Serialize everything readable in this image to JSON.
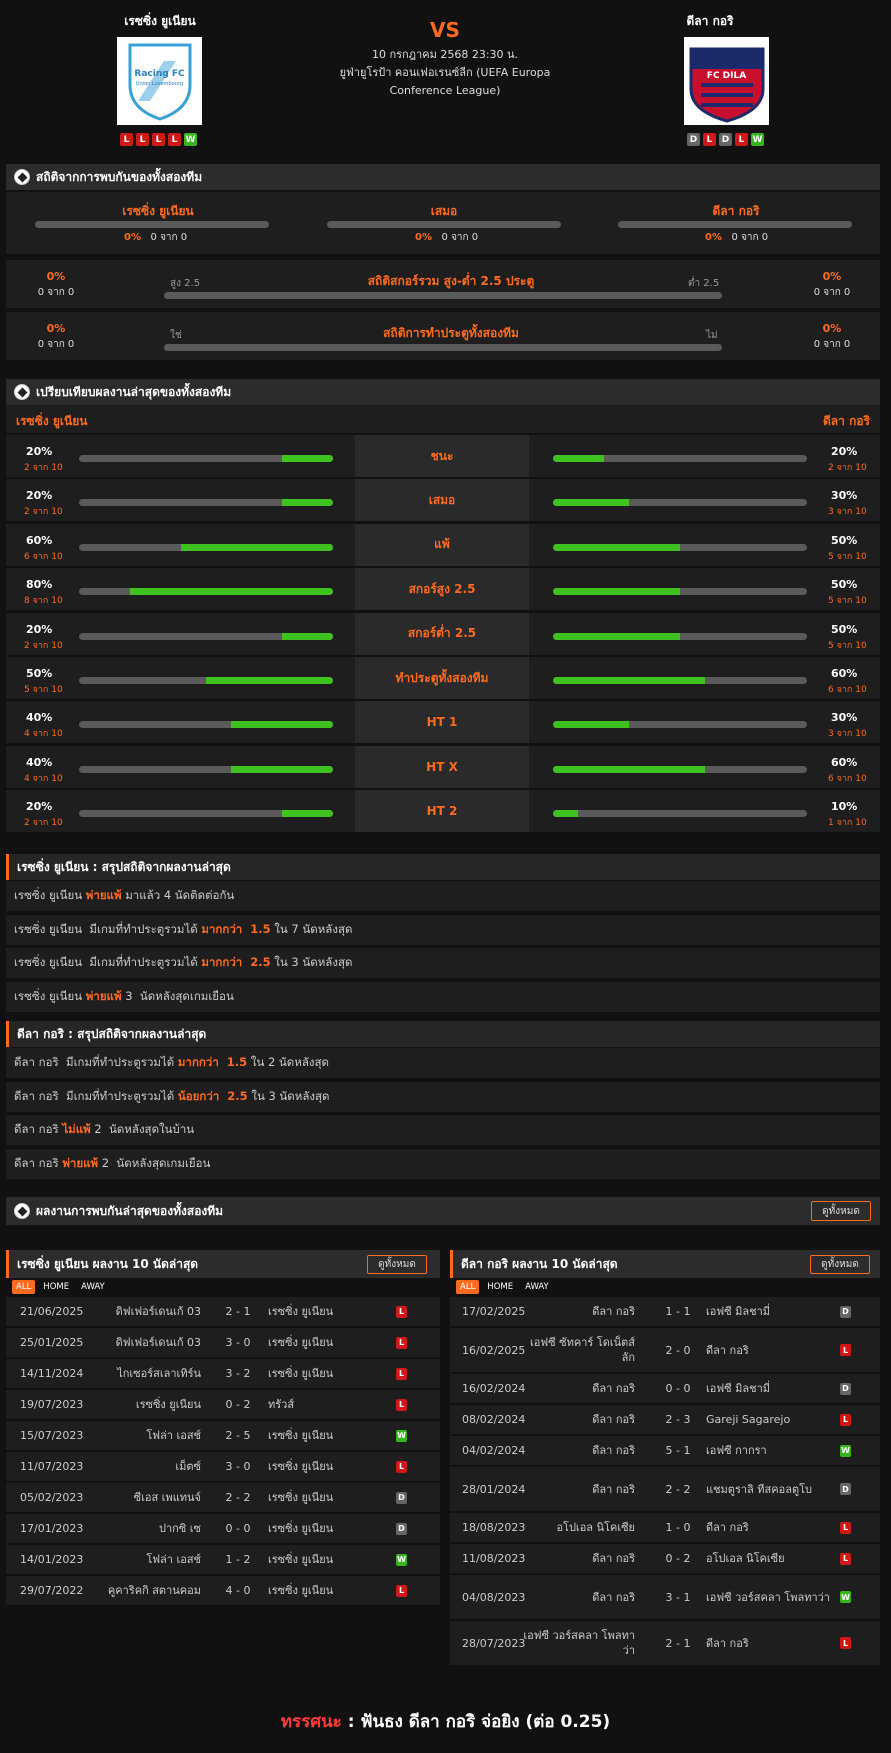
{
  "header": {
    "home_name": "เรซซิ่ง ยูเนียน",
    "away_name": "ดีลา กอริ",
    "vs": "VS",
    "datetime": "10 กรกฎาคม 2568 23:30 น.",
    "competition_line1": "ยูฟ่ายูโรป้า คอนเฟอเรนซ์ลีก (UEFA Europa",
    "competition_line2": "Conference League)",
    "home_logo_text": "Racing FC",
    "home_logo_sub": "Union Luxembourg",
    "away_logo_text": "FC DILA",
    "home_form": [
      "L",
      "L",
      "L",
      "L",
      "W"
    ],
    "away_form": [
      "D",
      "L",
      "D",
      "L",
      "W"
    ]
  },
  "h2h": {
    "title": "สถิติจากการพบกันของทั้งสองทีม",
    "cols": [
      {
        "label": "เรซซิ่ง ยูเนียน",
        "pct": "0%",
        "sub": "0 จาก 0"
      },
      {
        "label": "เสมอ",
        "pct": "0%",
        "sub": "0 จาก 0"
      },
      {
        "label": "ดีลา กอริ",
        "pct": "0%",
        "sub": "0 จาก 0"
      }
    ],
    "ou": {
      "title": "สถิติสกอร์รวม สูง-ต่ำ 2.5 ประตู",
      "left_label": "สูง 2.5",
      "right_label": "ต่ำ 2.5",
      "left_pct": "0%",
      "left_sub": "0 จาก 0",
      "right_pct": "0%",
      "right_sub": "0 จาก 0"
    },
    "btts": {
      "title": "สถิติการทำประตูทั้งสองทีม",
      "left_label": "ใช่",
      "right_label": "ไม่",
      "left_pct": "0%",
      "left_sub": "0 จาก 0",
      "right_pct": "0%",
      "right_sub": "0 จาก 0"
    }
  },
  "compare": {
    "title": "เปรียบเทียบผลงานล่าสุดของทั้งสองทีม",
    "home": "เรซซิ่ง ยูเนียน",
    "away": "ดีลา กอริ",
    "rows": [
      {
        "label": "ชนะ",
        "hp": "20%",
        "hs": "2 จาก 10",
        "hv": 0.2,
        "ap": "20%",
        "as": "2 จาก 10",
        "av": 0.2
      },
      {
        "label": "เสมอ",
        "hp": "20%",
        "hs": "2 จาก 10",
        "hv": 0.2,
        "ap": "30%",
        "as": "3 จาก 10",
        "av": 0.3
      },
      {
        "label": "แพ้",
        "hp": "60%",
        "hs": "6 จาก 10",
        "hv": 0.6,
        "ap": "50%",
        "as": "5 จาก 10",
        "av": 0.5
      },
      {
        "label": "สกอร์สูง 2.5",
        "hp": "80%",
        "hs": "8 จาก 10",
        "hv": 0.8,
        "ap": "50%",
        "as": "5 จาก 10",
        "av": 0.5
      },
      {
        "label": "สกอร์ต่ำ 2.5",
        "hp": "20%",
        "hs": "2 จาก 10",
        "hv": 0.2,
        "ap": "50%",
        "as": "5 จาก 10",
        "av": 0.5
      },
      {
        "label": "ทำประตูทั้งสองทีม",
        "hp": "50%",
        "hs": "5 จาก 10",
        "hv": 0.5,
        "ap": "60%",
        "as": "6 จาก 10",
        "av": 0.6
      },
      {
        "label": "HT 1",
        "hp": "40%",
        "hs": "4 จาก 10",
        "hv": 0.4,
        "ap": "30%",
        "as": "3 จาก 10",
        "av": 0.3
      },
      {
        "label": "HT X",
        "hp": "40%",
        "hs": "4 จาก 10",
        "hv": 0.4,
        "ap": "60%",
        "as": "6 จาก 10",
        "av": 0.6
      },
      {
        "label": "HT 2",
        "hp": "20%",
        "hs": "2 จาก 10",
        "hv": 0.2,
        "ap": "10%",
        "as": "1 จาก 10",
        "av": 0.1
      }
    ]
  },
  "summary_home": {
    "title": "เรซซิ่ง ยูเนียน : สรุปสถิติจากผลงานล่าสุด",
    "lines": [
      [
        "เรซซิ่ง ยูเนียน ",
        "พ่ายแพ้",
        " มาแล้ว 4 นัดติดต่อกัน"
      ],
      [
        "เรซซิ่ง ยูเนียน  มีเกมที่ทำประตูรวมได้ ",
        "มากกว่า  1.5",
        " ใน 7 นัดหลังสุด"
      ],
      [
        "เรซซิ่ง ยูเนียน  มีเกมที่ทำประตูรวมได้ ",
        "มากกว่า  2.5",
        " ใน 3 นัดหลังสุด"
      ],
      [
        "เรซซิ่ง ยูเนียน ",
        "พ่ายแพ้",
        " 3  นัดหลังสุดเกมเยือน"
      ]
    ]
  },
  "summary_away": {
    "title": "ดีลา กอริ : สรุปสถิติจากผลงานล่าสุด",
    "lines": [
      [
        "ดีลา กอริ  มีเกมที่ทำประตูรวมได้ ",
        "มากกว่า  1.5",
        " ใน 2 นัดหลังสุด"
      ],
      [
        "ดีลา กอริ  มีเกมที่ทำประตูรวมได้ ",
        "น้อยกว่า  2.5",
        " ใน 3 นัดหลังสุด"
      ],
      [
        "ดีลา กอริ ",
        "ไม่แพ้",
        " 2  นัดหลังสุดในบ้าน"
      ],
      [
        "ดีลา กอริ ",
        "พ่ายแพ้",
        " 2  นัดหลังสุดเกมเยือน"
      ]
    ]
  },
  "recent": {
    "title": "ผลงานการพบกันล่าสุดของทั้งสองทีม",
    "view_all": "ดูทั้งหมด"
  },
  "tabs": [
    "ALL",
    "HOME",
    "AWAY"
  ],
  "home_matches": {
    "title": "เรซซิ่ง ยูเนียน ผลงาน 10 นัดล่าสุด",
    "view_all": "ดูทั้งหมด",
    "rows": [
      [
        "21/06/2025",
        "ดิฟเฟอร์เดนเก้ 03",
        "2 - 1",
        "เรซซิ่ง ยูเนียน",
        "L"
      ],
      [
        "25/01/2025",
        "ดิฟเฟอร์เดนเก้ 03",
        "3 - 0",
        "เรซซิ่ง ยูเนียน",
        "L"
      ],
      [
        "14/11/2024",
        "ไกเซอร์สเลาเทิร์น",
        "3 - 2",
        "เรซซิ่ง ยูเนียน",
        "L"
      ],
      [
        "19/07/2023",
        "เรซซิ่ง ยูเนียน",
        "0 - 2",
        "ทรัวส์",
        "L"
      ],
      [
        "15/07/2023",
        "โฟล่า เอสช์",
        "2 - 5",
        "เรซซิ่ง ยูเนียน",
        "W"
      ],
      [
        "11/07/2023",
        "เม็ตซ์",
        "3 - 0",
        "เรซซิ่ง ยูเนียน",
        "L"
      ],
      [
        "05/02/2023",
        "ซีเอส เพแทนจ์",
        "2 - 2",
        "เรซซิ่ง ยูเนียน",
        "D"
      ],
      [
        "17/01/2023",
        "ปากซิ เซ",
        "0 - 0",
        "เรซซิ่ง ยูเนียน",
        "D"
      ],
      [
        "14/01/2023",
        "โฟล่า เอสช์",
        "1 - 2",
        "เรซซิ่ง ยูเนียน",
        "W"
      ],
      [
        "29/07/2022",
        "คูคาริคกิ สตานคอม",
        "4 - 0",
        "เรซซิ่ง ยูเนียน",
        "L"
      ]
    ]
  },
  "away_matches": {
    "title": "ดีลา กอริ ผลงาน 10 นัดล่าสุด",
    "view_all": "ดูทั้งหมด",
    "rows": [
      [
        "17/02/2025",
        "ดีลา กอริ",
        "1 - 1",
        "เอฟซี มิลชามี่",
        "D"
      ],
      [
        "16/02/2025",
        "เอฟซี ซัทคาร์ โดเน็ตส์\nลัก",
        "2 - 0",
        "ดีลา กอริ",
        "L"
      ],
      [
        "16/02/2024",
        "ดีลา กอริ",
        "0 - 0",
        "เอฟซี มิลชามี่",
        "D"
      ],
      [
        "08/02/2024",
        "ดีลา กอริ",
        "2 - 3",
        "Gareji Sagarejo",
        "L"
      ],
      [
        "04/02/2024",
        "ดีลา กอริ",
        "5 - 1",
        "เอฟซี กากรา",
        "W"
      ],
      [
        "28/01/2024",
        "ดีลา กอริ",
        "2 - 2",
        "แชมตูราลิ ทีสคอลตูโบ",
        "D"
      ],
      [
        "18/08/2023",
        "อโปเอล นิโคเซีย",
        "1 - 0",
        "ดีลา กอริ",
        "L"
      ],
      [
        "11/08/2023",
        "ดีลา กอริ",
        "0 - 2",
        "อโปเอล นิโคเซีย",
        "L"
      ],
      [
        "04/08/2023",
        "ดีลา กอริ",
        "3 - 1",
        "เอฟซี วอร์สคลา โพลทาว่า",
        "W"
      ],
      [
        "28/07/2023",
        "เอฟซี วอร์สคลา โพลทาว่า",
        "2 - 1",
        "ดีลา กอริ",
        "L"
      ]
    ]
  },
  "prediction": {
    "label": "ทรรศนะ",
    "sep": " : ",
    "text": "ฟันธง ดีลา กอริ จ่อยิง (ต่อ 0.25)"
  },
  "colors": {
    "accent": "#ff6a1f",
    "win": "#38b51c",
    "loss": "#d01818",
    "draw": "#666666",
    "bar_fill": "#3ec220"
  }
}
